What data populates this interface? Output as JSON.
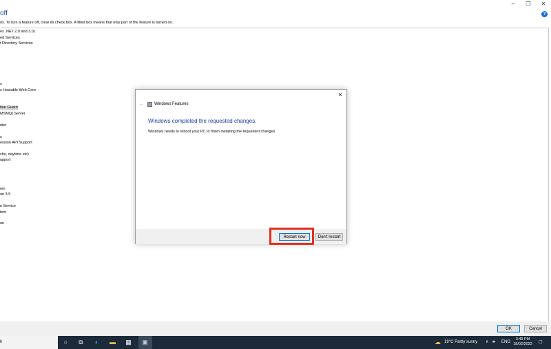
{
  "window": {
    "heading": "off",
    "instructions": "ox. To turn a feature off, clear its check box. A filled box means that only part of the feature is turned on.",
    "help_label": "?"
  },
  "feature_list": [
    {
      "label": "es .NET 2.0 and 3.0)",
      "selected": false
    },
    {
      "label": "ed Services",
      "selected": false
    },
    {
      "label": "t Directory Services",
      "selected": false
    },
    {
      "label": "s",
      "selected": false
    },
    {
      "label": "s Hostable Web Core",
      "selected": false
    },
    {
      "label": "tion Guard",
      "selected": true
    },
    {
      "label": "MSMQ) Server",
      "selected": false
    },
    {
      "label": "riter",
      "selected": false
    },
    {
      "label": "s",
      "selected": false
    },
    {
      "label": "ession API Support",
      "selected": false
    },
    {
      "label": "cho, daytime etc)",
      "selected": false
    },
    {
      "label": "upport",
      "selected": false
    },
    {
      "label": "em",
      "selected": false
    },
    {
      "label": "on 3.5",
      "selected": false
    },
    {
      "label": "n Service",
      "selected": false
    },
    {
      "label": "tem",
      "selected": false
    },
    {
      "label": "un",
      "selected": false
    }
  ],
  "bottom_buttons": {
    "ok": "OK",
    "cancel": "Cancel"
  },
  "dialog": {
    "title": "Windows Features",
    "heading": "Windows completed the requested changes.",
    "message": "Windows needs to reboot your PC to finish installing the requested changes.",
    "restart_now": "Restart now",
    "dont_restart": "Don't restart"
  },
  "taskbar": {
    "search_text": "h",
    "weather": "19°C  Partly sunny",
    "language": "ENG",
    "time": "3:49 PM",
    "date": "18/02/2022"
  },
  "colors": {
    "accent": "#1f3f99",
    "highlight": "#e0301e",
    "taskbar": "#1c2a3a"
  }
}
